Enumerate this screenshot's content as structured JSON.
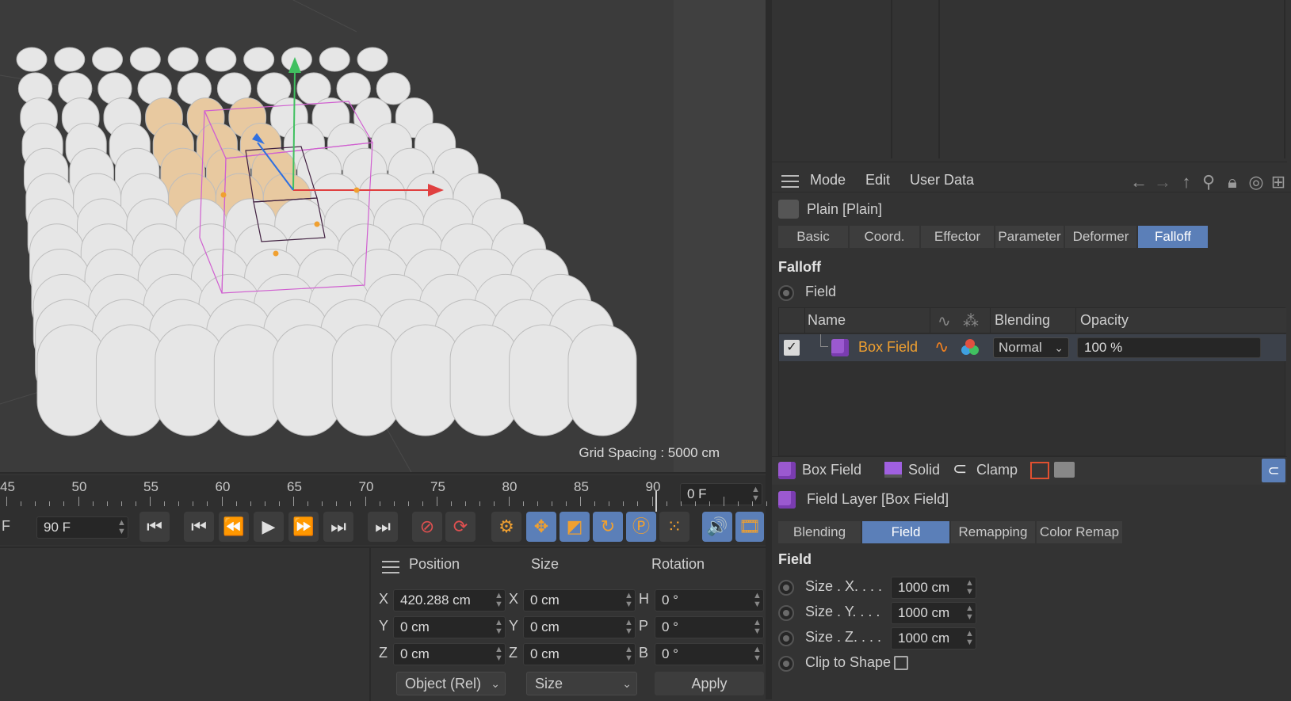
{
  "viewport": {
    "grid_spacing": "Grid Spacing : 5000 cm"
  },
  "attributes": {
    "menu": [
      "Mode",
      "Edit",
      "User Data"
    ],
    "object_title": "Plain [Plain]",
    "tabs": [
      "Basic",
      "Coord.",
      "Effector",
      "Parameter",
      "Deformer",
      "Falloff"
    ],
    "active_tab": "Falloff",
    "falloff_section": "Falloff",
    "field_label": "Field",
    "list_headers": {
      "name": "Name",
      "blending": "Blending",
      "opacity": "Opacity"
    },
    "field_row": {
      "name": "Box Field",
      "blending": "Normal",
      "opacity": "100 %",
      "enabled": true
    },
    "bottom_bar": {
      "box_field": "Box Field",
      "solid": "Solid",
      "clamp": "Clamp"
    },
    "layer_title": "Field Layer [Box Field]",
    "layer_tabs": [
      "Blending",
      "Field",
      "Remapping",
      "Color Remap"
    ],
    "layer_active_tab": "Field",
    "field_section": "Field",
    "size_x_label": "Size . X. . . .",
    "size_y_label": "Size . Y. . . .",
    "size_z_label": "Size . Z. . . .",
    "size_x": "1000 cm",
    "size_y": "1000 cm",
    "size_z": "1000 cm",
    "clip_label": "Clip to Shape"
  },
  "timeline": {
    "ruler": [
      "45",
      "50",
      "55",
      "60",
      "65",
      "70",
      "75",
      "80",
      "85",
      "90"
    ],
    "current_frame": "0 F",
    "end_frame": "90 F",
    "start_frame_fragment": "F"
  },
  "coords": {
    "headers": {
      "position": "Position",
      "size": "Size",
      "rotation": "Rotation"
    },
    "position": {
      "x": "420.288 cm",
      "y": "0 cm",
      "z": "0 cm"
    },
    "size": {
      "x": "0 cm",
      "y": "0 cm",
      "z": "0 cm"
    },
    "rotation": {
      "h": "0 °",
      "p": "0 °",
      "b": "0 °"
    },
    "axis_pos": [
      "X",
      "Y",
      "Z"
    ],
    "axis_rot": [
      "H",
      "P",
      "B"
    ],
    "mode_dropdown": "Object (Rel)",
    "size_dropdown": "Size",
    "apply": "Apply"
  },
  "colors": {
    "accent": "#5b7fb8",
    "field_name": "#f0a030",
    "cube": "#9b59d0"
  }
}
